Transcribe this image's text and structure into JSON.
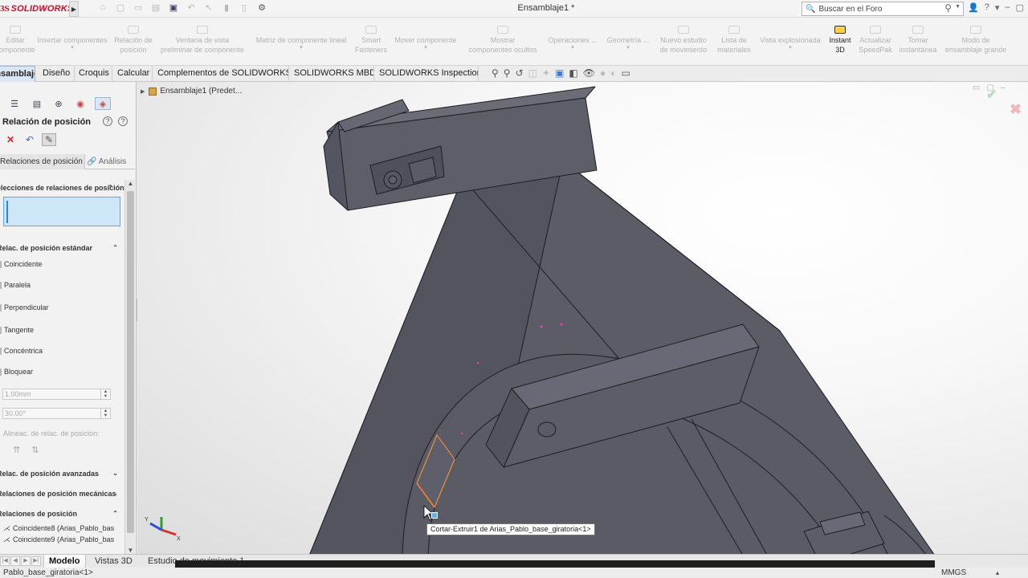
{
  "titlebar": {
    "brand": "SOLIDWORKS",
    "brand_mark": "3S",
    "doc_title": "Ensamblaje1 *",
    "search_placeholder": "Buscar en el Foro"
  },
  "commandmanager": {
    "items": [
      {
        "label": "Editar\ncomponente"
      },
      {
        "label": "Insertar componentes"
      },
      {
        "label": "Relación de\nposición"
      },
      {
        "label": "Ventana de vista\npreliminar de componente"
      },
      {
        "label": "Matriz de componente lineal"
      },
      {
        "label": "Smart\nFasteners"
      },
      {
        "label": "Mover componente"
      },
      {
        "label": "Mostrar\ncomponentes ocultos"
      },
      {
        "label": "Operaciones ..."
      },
      {
        "label": "Geometría ..."
      },
      {
        "label": "Nuevo estudio\nde movimiento"
      },
      {
        "label": "Lista de\nmateriales"
      },
      {
        "label": "Vista explosionada"
      },
      {
        "label": "Instant\n3D"
      },
      {
        "label": "Actualizar\nSpeedPak"
      },
      {
        "label": "Tomar\ninstantánea"
      },
      {
        "label": "Modo de\nensamblaje grande"
      }
    ]
  },
  "tabs": [
    {
      "label": "Ensamblaje"
    },
    {
      "label": "Diseño"
    },
    {
      "label": "Croquis"
    },
    {
      "label": "Calcular"
    },
    {
      "label": "Complementos de SOLIDWORKS"
    },
    {
      "label": "SOLIDWORKS MBD"
    },
    {
      "label": "SOLIDWORKS Inspection"
    }
  ],
  "property_manager": {
    "title": "Relación de posición",
    "subtabs": {
      "relations": "Relaciones de posición",
      "analysis": "Análisis"
    },
    "groups": {
      "selections": "Selecciones de relaciones de posición",
      "standard": "Relac. de posición estándar",
      "advanced": "Relac. de posición avanzadas",
      "mechanical": "Relaciones de posición mecánicas",
      "mates": "Relaciones de posición"
    },
    "standard_items": [
      "Coincidente",
      "Paralela",
      "Perpendicular",
      "Tangente",
      "Concéntrica",
      "Bloquear"
    ],
    "distance_value": "1.00mm",
    "angle_value": "30.00°",
    "alignment_label": "Alineac. de relac. de posición:",
    "mates": [
      "Coincidente8 (Arias_Pablo_bas",
      "Coincidente9 (Arias_Pablo_bas"
    ]
  },
  "viewport": {
    "tree_root": "Ensamblaje1  (Predet...",
    "tooltip": "Cortar-Extruir1 de Arias_Pablo_base_giratoria<1>"
  },
  "bottom_tabs": [
    {
      "label": "Modelo"
    },
    {
      "label": "Vistas 3D"
    },
    {
      "label": "Estudio de movimiento 1"
    }
  ],
  "status": {
    "left_text": "Pablo_base_giratoria<1>",
    "units": "MMGS"
  },
  "colors": {
    "brand_red": "#c8102e",
    "model_gray": "#5b5c66",
    "selection_blue": "#cde6f8",
    "active_tab": "#dbe6f4"
  }
}
